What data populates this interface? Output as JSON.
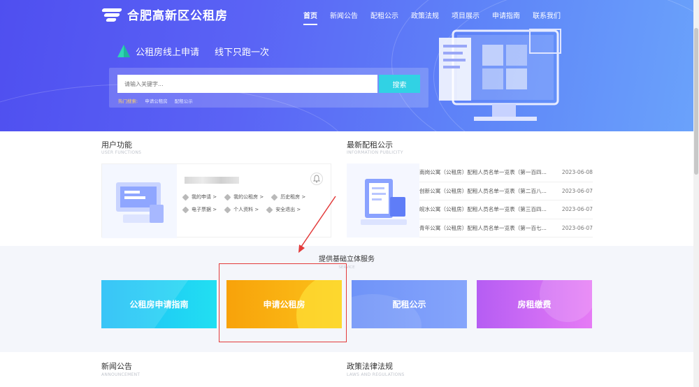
{
  "header": {
    "site_title": "合肥高新区公租房",
    "nav": [
      "首页",
      "新闻公告",
      "配租公示",
      "政策法规",
      "项目展示",
      "申请指南",
      "联系我们"
    ],
    "active_nav": "首页"
  },
  "hero": {
    "slogan_left": "公租房线上申请",
    "slogan_right": "线下只跑一次",
    "search_placeholder": "请输入关键字...",
    "search_button": "搜索",
    "hot_label": "热门搜索:",
    "hot_tags": [
      "申请公租房",
      "配租公示"
    ]
  },
  "user_functions": {
    "title": "用户功能",
    "subtitle": "USER FUNCTIONS",
    "links": [
      "我的申请 >",
      "我的公租房 >",
      "历史租房 >",
      "电子票据 >",
      "个人资料 >",
      "安全退出 >"
    ]
  },
  "latest_notices": {
    "title": "最新配租公示",
    "subtitle": "INFORMATION PUBLICITY",
    "items": [
      {
        "text": "南岗公寓（公租房）配租人员名单一览表（第一百四...",
        "date": "2023-06-08"
      },
      {
        "text": "创新公寓（公租房）配租人员名单一览表（第二百八...",
        "date": "2023-06-07"
      },
      {
        "text": "皖水公寓（公租房）配租人员名单一览表（第三百四...",
        "date": "2023-06-07"
      },
      {
        "text": "青年公寓（公租房）配租人员名单一览表（第一百七...",
        "date": "2023-06-07"
      }
    ]
  },
  "services": {
    "title": "提供基础立体服务",
    "subtitle": "SERVICE",
    "tiles": [
      "公租房申请指南",
      "申请公租房",
      "配租公示",
      "房租缴费"
    ]
  },
  "news": {
    "title": "新闻公告",
    "subtitle": "ANNOUNCEMENT"
  },
  "policy": {
    "title": "政策法律法规",
    "subtitle": "LAWS AND REGULATIONS"
  },
  "colors": {
    "accent": "#31d2e4",
    "highlight": "#e33a3a"
  }
}
